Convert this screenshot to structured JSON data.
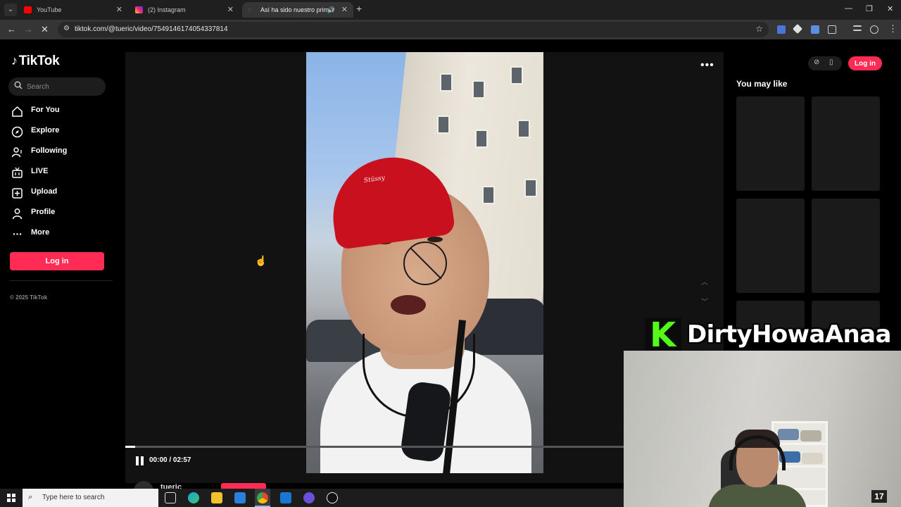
{
  "browser": {
    "tabs": [
      {
        "label": "YouTube",
        "icon": "youtube-icon",
        "color": "#ff0000",
        "active": false
      },
      {
        "label": "(2) Instagram",
        "icon": "instagram-icon",
        "color": "#d62976",
        "active": false
      },
      {
        "label": "Así ha sido nuestro primer",
        "icon": "loading-icon",
        "color": "#9a9a9a",
        "active": true
      }
    ],
    "url": "tiktok.com/@tueric/video/7549146174054337814"
  },
  "tiktok": {
    "logo": "TikTok",
    "search_placeholder": "Search",
    "nav": [
      {
        "label": "For You",
        "icon": "home-icon"
      },
      {
        "label": "Explore",
        "icon": "compass-icon"
      },
      {
        "label": "Following",
        "icon": "following-icon"
      },
      {
        "label": "LIVE",
        "icon": "live-icon"
      },
      {
        "label": "Upload",
        "icon": "upload-icon"
      },
      {
        "label": "Profile",
        "icon": "profile-icon"
      },
      {
        "label": "More",
        "icon": "more-icon"
      }
    ],
    "login_label": "Log in",
    "copyright": "© 2025 TikTok",
    "accent": "#fe2c55"
  },
  "player": {
    "time": "00:00 / 02:57",
    "progress": 0.003,
    "author": "tueric",
    "beanie_text": "Stüssy"
  },
  "right": {
    "login_label": "Log in",
    "may_like": "You may like"
  },
  "overlay": {
    "badge": "K",
    "name": "DirtyHowaAnaa",
    "badge_color": "#53fc18"
  },
  "taskbar": {
    "search_placeholder": "Type here to search"
  }
}
